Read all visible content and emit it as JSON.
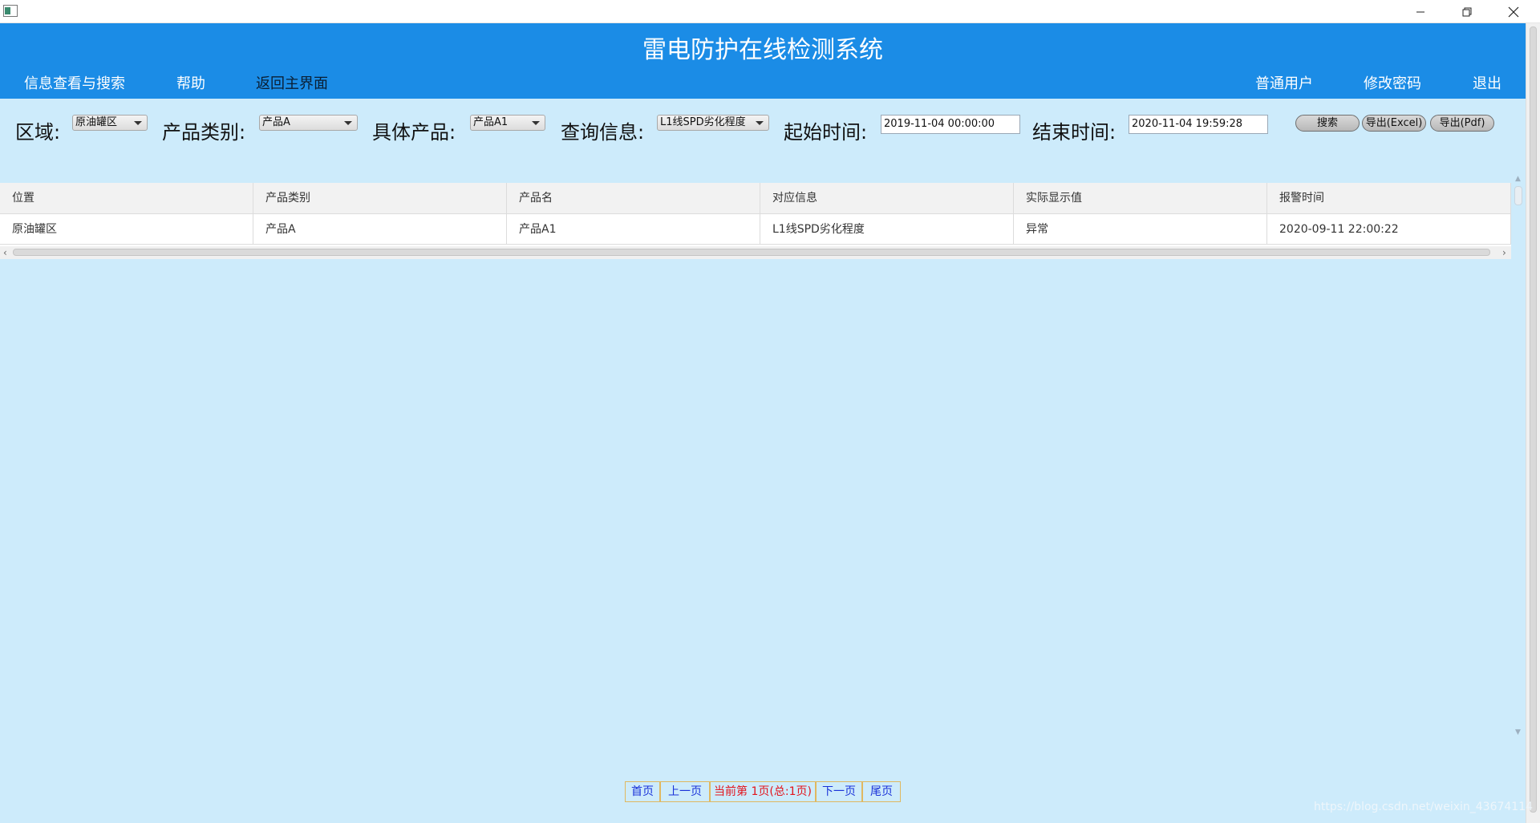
{
  "window": {
    "minimize_icon": "minimize-icon",
    "restore_icon": "restore-icon",
    "close_icon": "close-icon"
  },
  "header": {
    "title": "雷电防护在线检测系统",
    "nav_left": [
      "信息查看与搜索",
      "帮助",
      "返回主界面"
    ],
    "nav_right": [
      "普通用户",
      "修改密码",
      "退出"
    ],
    "background": "#1b8ce6"
  },
  "filters": {
    "region_label": "区域:",
    "region_value": "原油罐区",
    "category_label": "产品类别:",
    "category_value": "产品A",
    "product_label": "具体产品:",
    "product_value": "产品A1",
    "query_label": "查询信息:",
    "query_value": "L1线SPD劣化程度",
    "start_label": "起始时间:",
    "start_value": "2019-11-04 00:00:00",
    "end_label": "结束时间:",
    "end_value": "2020-11-04 19:59:28",
    "search_button": "搜索",
    "export_excel_button": "导出(Excel)",
    "export_pdf_button": "导出(Pdf)"
  },
  "table": {
    "columns": [
      "位置",
      "产品类别",
      "产品名",
      "对应信息",
      "实际显示值",
      "报警时间"
    ],
    "rows": [
      [
        "原油罐区",
        "产品A",
        "产品A1",
        "L1线SPD劣化程度",
        "异常",
        "2020-09-11 22:00:22"
      ]
    ]
  },
  "pagination": {
    "first": "首页",
    "prev": "上一页",
    "current": "当前第 1页(总:1页)",
    "next": "下一页",
    "last": "尾页"
  },
  "watermark": "https://blog.csdn.net/weixin_43674114"
}
